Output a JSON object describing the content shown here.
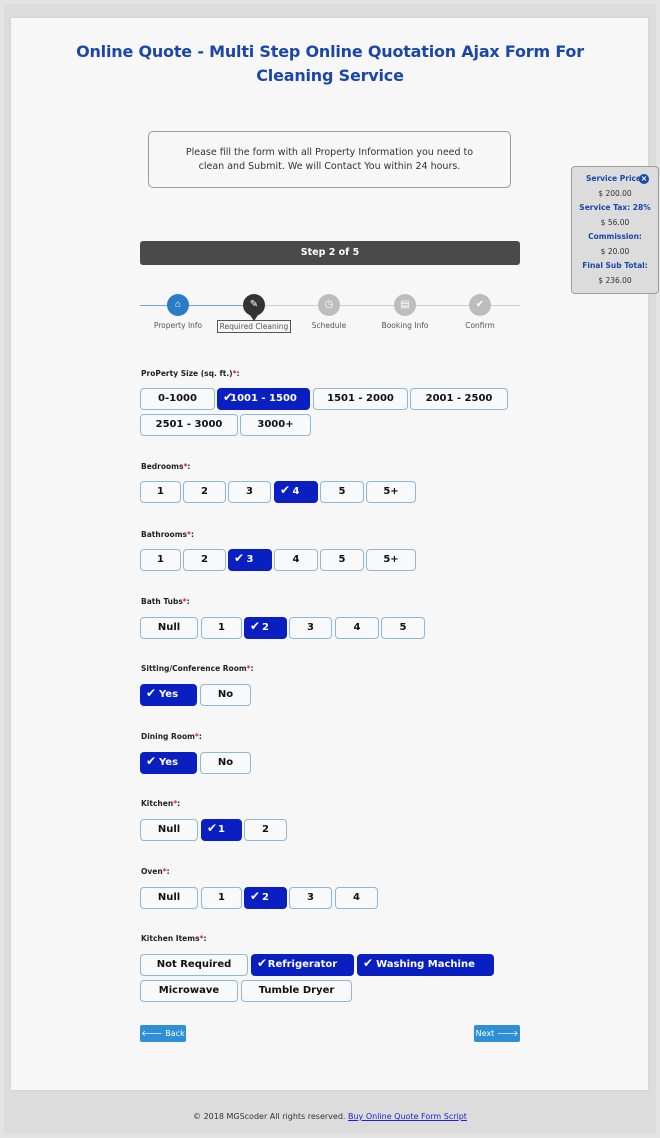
{
  "header": {
    "title": "Online Quote - Multi Step Online Quotation Ajax Form For Cleaning Service",
    "notice": "Please fill the form with all Property Information you need to clean and Submit. We will Contact You within 24 hours."
  },
  "price_panel": {
    "close_icon": "close-circle-icon",
    "items": [
      {
        "label": "Service Price:",
        "value": "$ 200.00"
      },
      {
        "label": "Service Tax: 28%",
        "value": "$ 56.00"
      },
      {
        "label": "Commission:",
        "value": "$ 20.00"
      },
      {
        "label": "Final Sub Total:",
        "value": "$ 236.00"
      }
    ]
  },
  "step_bar": {
    "label": "Step 2 of 5",
    "current": 2,
    "total": 5
  },
  "steps": [
    {
      "label": "Property Info",
      "icon": "home-icon",
      "glyph": "⌂",
      "state": "done"
    },
    {
      "label": "Required Cleaning",
      "icon": "brush-icon",
      "glyph": "✎",
      "state": "current"
    },
    {
      "label": "Schedule",
      "icon": "clock-icon",
      "glyph": "◷",
      "state": "pending"
    },
    {
      "label": "Booking Info",
      "icon": "id-card-icon",
      "glyph": "▤",
      "state": "pending"
    },
    {
      "label": "Confirm",
      "icon": "check-icon",
      "glyph": "✔",
      "state": "pending"
    }
  ],
  "fields": {
    "property_size": {
      "label": "ProPerty Size (sq. ft.)",
      "options": [
        "0-1000",
        "1001 - 1500",
        "1501 - 2000",
        "2001 - 2500",
        "2501 - 3000",
        "3000+"
      ],
      "selected": [
        "1001 - 1500"
      ]
    },
    "bedrooms": {
      "label": "Bedrooms",
      "options": [
        "1",
        "2",
        "3",
        "4",
        "5",
        "5+"
      ],
      "selected": [
        "4"
      ]
    },
    "bathrooms": {
      "label": "Bathrooms",
      "options": [
        "1",
        "2",
        "3",
        "4",
        "5",
        "5+"
      ],
      "selected": [
        "3"
      ]
    },
    "bath_tubs": {
      "label": "Bath Tubs",
      "options": [
        "Null",
        "1",
        "2",
        "3",
        "4",
        "5"
      ],
      "selected": [
        "2"
      ]
    },
    "sitting_room": {
      "label": "Sitting/Conference Room",
      "options": [
        "Yes",
        "No"
      ],
      "selected": [
        "Yes"
      ]
    },
    "dining_room": {
      "label": "Dining Room",
      "options": [
        "Yes",
        "No"
      ],
      "selected": [
        "Yes"
      ]
    },
    "kitchen": {
      "label": "Kitchen",
      "options": [
        "Null",
        "1",
        "2"
      ],
      "selected": [
        "1"
      ]
    },
    "oven": {
      "label": "Oven",
      "options": [
        "Null",
        "1",
        "2",
        "3",
        "4"
      ],
      "selected": [
        "2"
      ]
    },
    "kitchen_items": {
      "label": "Kitchen Items",
      "options": [
        "Not Required",
        "Refrigerator",
        "Washing Machine",
        "Microwave",
        "Tumble Dryer"
      ],
      "selected": [
        "Refrigerator",
        "Washing Machine"
      ]
    }
  },
  "required_mark": "*",
  "label_suffix": ":",
  "check_glyph": "✔",
  "nav": {
    "back": "🡐 Back",
    "next": "Next 🡒"
  },
  "footer": {
    "text": "© 2018 MGScoder All rights reserved.",
    "link": "Buy Online Quote Form Script"
  },
  "colors": {
    "accent": "#1a47a8",
    "selected": "#0a1fc2",
    "button": "#2f8fd6",
    "step_bar": "#4a4a4a"
  }
}
